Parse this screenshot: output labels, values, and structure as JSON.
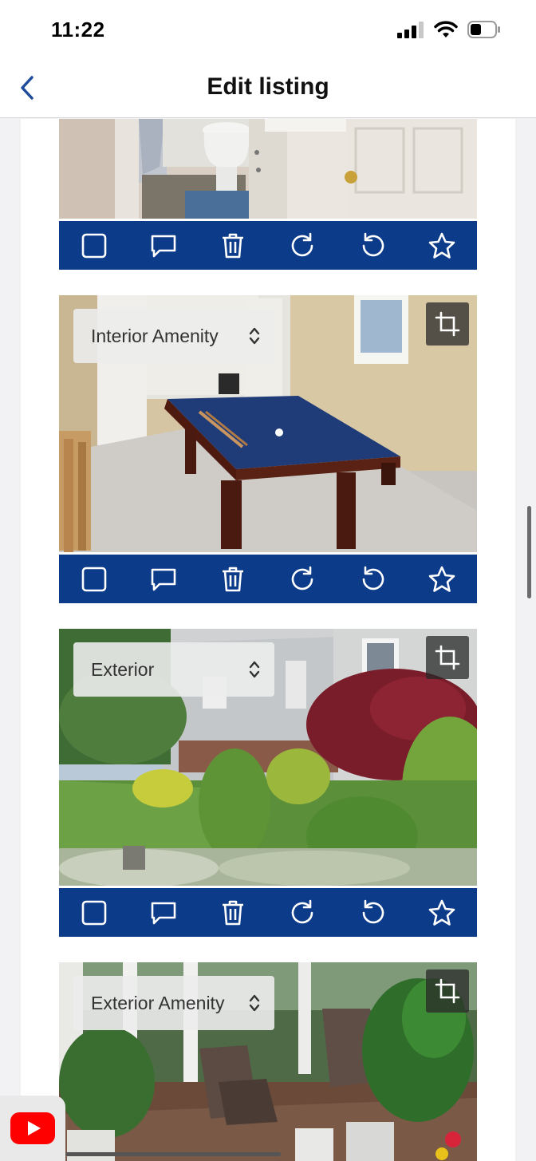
{
  "status_bar": {
    "time": "11:22"
  },
  "nav": {
    "title": "Edit listing"
  },
  "listing_photos": [
    {
      "category": "",
      "has_category": false
    },
    {
      "category": "Interior Amenity",
      "has_category": true
    },
    {
      "category": "Exterior",
      "has_category": true
    },
    {
      "category": "Exterior Amenity",
      "has_category": true
    }
  ],
  "toolbar_icons": [
    "checkbox-icon",
    "comment-icon",
    "trash-icon",
    "rotate-clockwise-icon",
    "rotate-counterclockwise-icon",
    "star-icon"
  ],
  "colors": {
    "toolbar": "#0c3b8a",
    "nav_accent": "#1e4c9a",
    "youtube_red": "#ff0000"
  }
}
